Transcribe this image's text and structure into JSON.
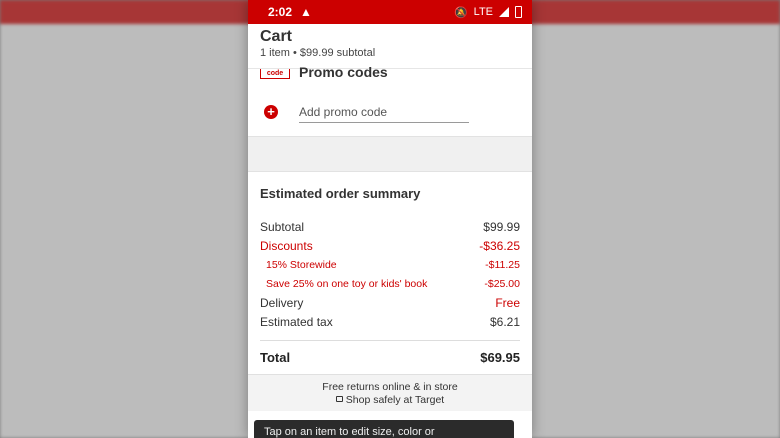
{
  "status": {
    "time": "2:02",
    "warning_icon": "alert-triangle-icon",
    "network": "LTE"
  },
  "cart": {
    "title": "Cart",
    "subtitle": "1 item • $99.99 subtotal"
  },
  "promo": {
    "badge": "code",
    "title": "Promo codes",
    "add_label": "Add promo code"
  },
  "summary": {
    "title": "Estimated order summary",
    "rows": [
      {
        "label": "Subtotal",
        "value": "$99.99"
      },
      {
        "label": "Discounts",
        "value": "-$36.25"
      },
      {
        "label": "15% Storewide",
        "value": "-$11.25"
      },
      {
        "label": "Save 25% on one toy or kids' book",
        "value": "-$25.00"
      },
      {
        "label": "Delivery",
        "value": "Free"
      },
      {
        "label": "Estimated tax",
        "value": "$6.21"
      }
    ],
    "total_label": "Total",
    "total_value": "$69.95"
  },
  "footer": {
    "line1": "Free returns online & in store",
    "line2": "Shop safely at Target"
  },
  "toast": {
    "text": "Tap on an item to edit size, color or"
  },
  "colors": {
    "brand_red": "#cc0000"
  }
}
